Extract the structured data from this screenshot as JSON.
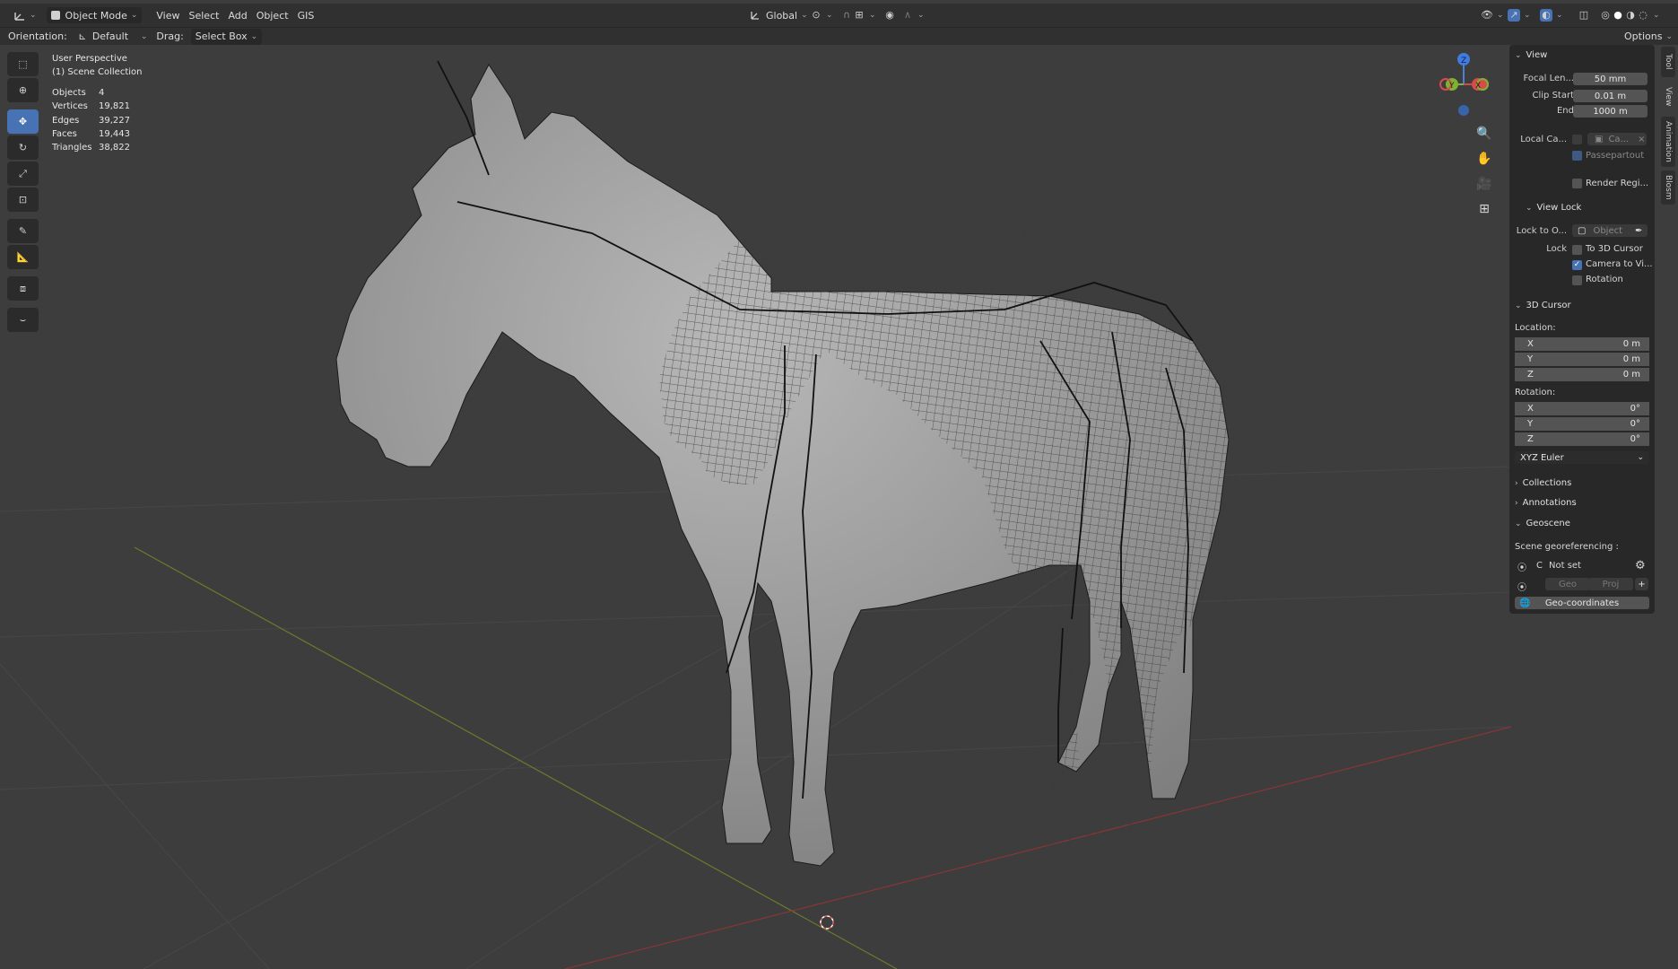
{
  "header": {
    "mode": "Object Mode",
    "menus": [
      "View",
      "Select",
      "Add",
      "Object",
      "GIS"
    ],
    "transform_orientation": "Global",
    "options_label": "Options"
  },
  "tool_header": {
    "orientation_label": "Orientation:",
    "orientation_value": "Default",
    "drag_label": "Drag:",
    "drag_value": "Select Box"
  },
  "viewport": {
    "perspective": "User Perspective",
    "collection": "(1) Scene Collection",
    "stats": [
      {
        "k": "Objects",
        "v": "4"
      },
      {
        "k": "Vertices",
        "v": "19,821"
      },
      {
        "k": "Edges",
        "v": "39,227"
      },
      {
        "k": "Faces",
        "v": "19,443"
      },
      {
        "k": "Triangles",
        "v": "38,822"
      }
    ],
    "gizmo": {
      "z": "Z",
      "y": "Y",
      "x": "X"
    }
  },
  "sidebar_tabs": [
    "Tool",
    "View",
    "Animation",
    "Blosm"
  ],
  "npanel": {
    "view": {
      "title": "View",
      "focal_label": "Focal Len...",
      "focal_value": "50 mm",
      "clip_start_label": "Clip Start",
      "clip_start_value": "0.01 m",
      "end_label": "End",
      "end_value": "1000 m",
      "local_cam_label": "Local Ca...",
      "local_cam_value": "Ca...",
      "passepartout": "Passepartout",
      "render_region": "Render Regi..."
    },
    "view_lock": {
      "title": "View Lock",
      "lock_to_label": "Lock to O...",
      "lock_to_value": "Object",
      "lock_label": "Lock",
      "to_cursor": "To 3D Cursor",
      "camera_to_view": "Camera to Vi...",
      "rotation": "Rotation"
    },
    "cursor": {
      "title": "3D Cursor",
      "location_label": "Location:",
      "loc": [
        {
          "a": "X",
          "v": "0 m"
        },
        {
          "a": "Y",
          "v": "0 m"
        },
        {
          "a": "Z",
          "v": "0 m"
        }
      ],
      "rotation_label": "Rotation:",
      "rot": [
        {
          "a": "X",
          "v": "0°"
        },
        {
          "a": "Y",
          "v": "0°"
        },
        {
          "a": "Z",
          "v": "0°"
        }
      ],
      "rotation_mode": "XYZ Euler"
    },
    "collections": "Collections",
    "annotations": "Annotations",
    "geoscene": {
      "title": "Geoscene",
      "georef_label": "Scene georeferencing :",
      "crs_letter": "C",
      "crs_value": "Not set",
      "geo_btn": "Geo",
      "proj_btn": "Proj",
      "geo_coords": "Geo-coordinates"
    }
  }
}
